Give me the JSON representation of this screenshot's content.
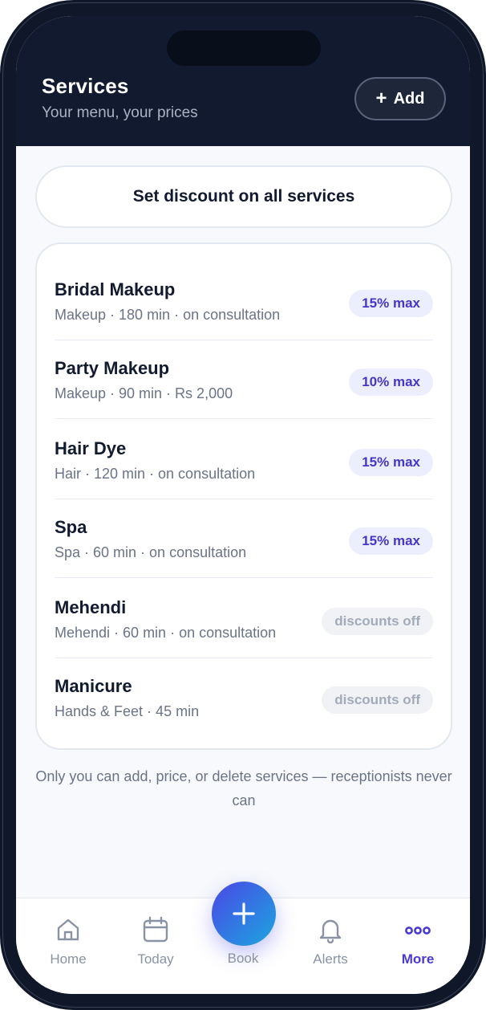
{
  "header": {
    "title": "Services",
    "subtitle": "Your menu, your prices",
    "add_label": "Add"
  },
  "discount_button_label": "Set discount on all services",
  "services": [
    {
      "name": "Bridal Makeup",
      "meta": "Makeup · 180 min · on consultation",
      "badge": "15% max",
      "badge_type": "max"
    },
    {
      "name": "Party Makeup",
      "meta": "Makeup · 90 min · Rs 2,000",
      "badge": "10% max",
      "badge_type": "max"
    },
    {
      "name": "Hair Dye",
      "meta": "Hair · 120 min · on consultation",
      "badge": "15% max",
      "badge_type": "max"
    },
    {
      "name": "Spa",
      "meta": "Spa · 60 min · on consultation",
      "badge": "15% max",
      "badge_type": "max"
    },
    {
      "name": "Mehendi",
      "meta": "Mehendi · 60 min · on consultation",
      "badge": "discounts off",
      "badge_type": "off"
    },
    {
      "name": "Manicure",
      "meta": "Hands & Feet · 45 min",
      "badge": "discounts off",
      "badge_type": "off"
    }
  ],
  "footnote": "Only you can add, price, or delete services — receptionists never can",
  "tabbar": {
    "tabs": [
      {
        "label": "Home",
        "icon": "home-icon",
        "active": false
      },
      {
        "label": "Today",
        "icon": "calendar-icon",
        "active": false
      },
      {
        "label": "Book",
        "icon": "plus-icon",
        "active": false
      },
      {
        "label": "Alerts",
        "icon": "bell-icon",
        "active": false
      },
      {
        "label": "More",
        "icon": "more-dots-icon",
        "active": true
      }
    ]
  },
  "colors": {
    "header_bg": "#111a2e",
    "accent": "#4b3ad2",
    "badge_max_bg": "#eceefe",
    "badge_off_bg": "#f0f2f5",
    "fab_gradient_start": "#4a47e6",
    "fab_gradient_end": "#1ca6df"
  }
}
